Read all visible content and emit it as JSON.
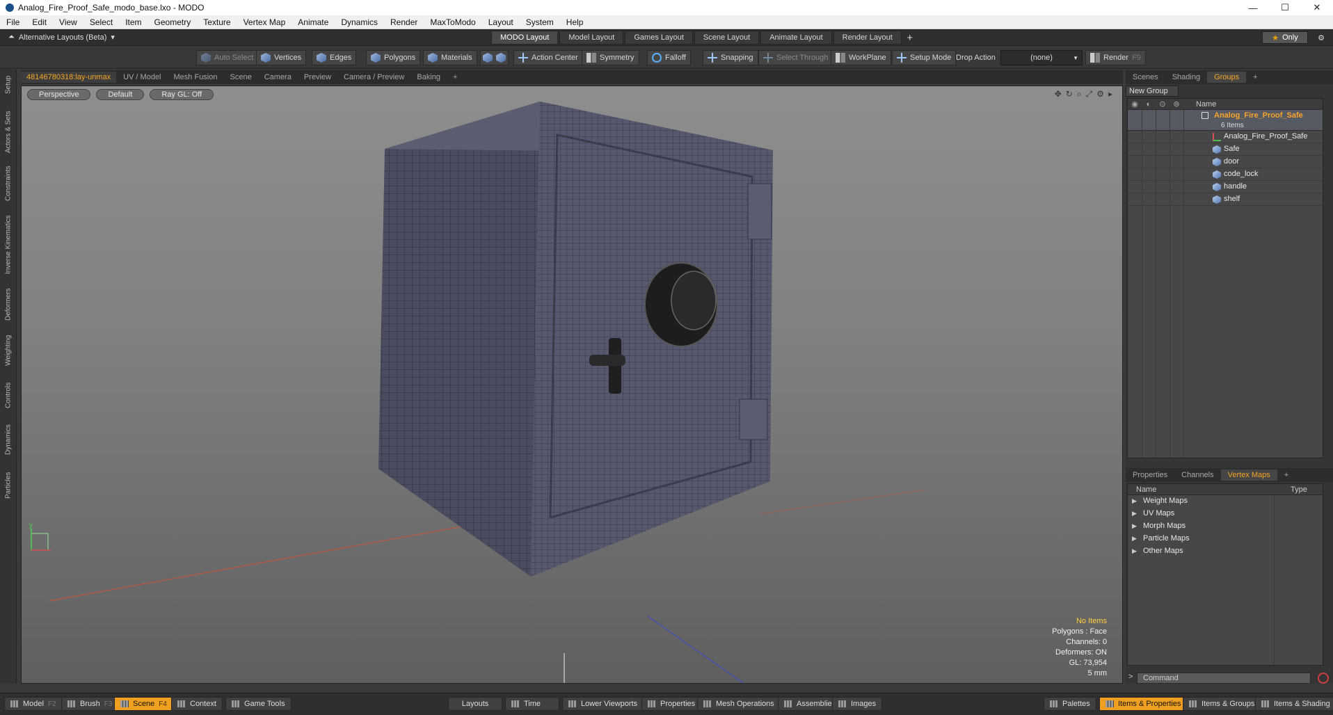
{
  "window": {
    "title": "Analog_Fire_Proof_Safe_modo_base.lxo - MODO",
    "minimize": "—",
    "maximize": "☐",
    "close": "✕"
  },
  "menu": [
    "File",
    "Edit",
    "View",
    "Select",
    "Item",
    "Geometry",
    "Texture",
    "Vertex Map",
    "Animate",
    "Dynamics",
    "Render",
    "MaxToModo",
    "Layout",
    "System",
    "Help"
  ],
  "layoutbar": {
    "alt_layouts": "Alternative Layouts (Beta)",
    "tabs": [
      "MODO Layout",
      "Model Layout",
      "Games Layout",
      "Scene Layout",
      "Animate Layout",
      "Render Layout"
    ],
    "active_tab": 0,
    "plus": "+",
    "only_label": "Only"
  },
  "toolbar": {
    "auto_select": "Auto Select",
    "vertices": "Vertices",
    "edges": "Edges",
    "polygons": "Polygons",
    "materials": "Materials",
    "action_center": "Action Center",
    "symmetry": "Symmetry",
    "falloff": "Falloff",
    "snapping": "Snapping",
    "select_through": "Select Through",
    "workplane": "WorkPlane",
    "setup_mode": "Setup Mode",
    "drop_action": "Drop Action",
    "drop_value": "(none)",
    "render": "Render",
    "render_key": "F9"
  },
  "left_tabs": [
    "Setup",
    "Actors & Sets",
    "Constraints",
    "Inverse Kinematics",
    "Deformers",
    "Weighting",
    "Controls",
    "Dynamics",
    "Particles"
  ],
  "viewport_tabs": [
    "48146780318:lay-unmax",
    "UV / Model",
    "Mesh Fusion",
    "Scene",
    "Camera",
    "Preview",
    "Camera / Preview",
    "Baking",
    "+"
  ],
  "viewport": {
    "view": "Perspective",
    "shading": "Default",
    "raygl": "Ray GL: Off",
    "info": {
      "selection": "No Items",
      "polygons": "Polygons : Face",
      "channels": "Channels: 0",
      "deformers": "Deformers: ON",
      "gl": "GL: 73,954",
      "units": "5 mm"
    }
  },
  "scene_panel": {
    "tabs": [
      "Scenes",
      "Shading",
      "Groups",
      "+"
    ],
    "active": 2,
    "new_group": "New Group",
    "header_name": "Name",
    "group_name": "Analog_Fire_Proof_Safe",
    "group_count": "6 Items",
    "items": [
      {
        "label": "Analog_Fire_Proof_Safe",
        "icon": "locator-icon"
      },
      {
        "label": "Safe",
        "icon": "mesh-icon"
      },
      {
        "label": "door",
        "icon": "mesh-icon"
      },
      {
        "label": "code_lock",
        "icon": "mesh-icon"
      },
      {
        "label": "handle",
        "icon": "mesh-icon"
      },
      {
        "label": "shelf",
        "icon": "mesh-icon"
      }
    ]
  },
  "props_panel": {
    "tabs": [
      "Properties",
      "Channels",
      "Vertex Maps",
      "+"
    ],
    "active": 2,
    "col_name": "Name",
    "col_type": "Type",
    "maps": [
      "Weight Maps",
      "UV Maps",
      "Morph Maps",
      "Particle Maps",
      "Other Maps"
    ],
    "command_placeholder": "Command"
  },
  "statusbar": {
    "model": "Model",
    "model_key": "F2",
    "brush": "Brush",
    "brush_key": "F3",
    "scene": "Scene",
    "scene_key": "F4",
    "context": "Context",
    "game_tools": "Game Tools",
    "layouts": "Layouts",
    "time": "Time",
    "lower_viewports": "Lower Viewports",
    "properties": "Properties",
    "mesh_operations": "Mesh Operations",
    "assemblies": "Assemblies",
    "images": "Images",
    "palettes": "Palettes",
    "items_properties": "Items & Properties",
    "items_groups": "Items & Groups",
    "items_shading": "Items & Shading"
  }
}
